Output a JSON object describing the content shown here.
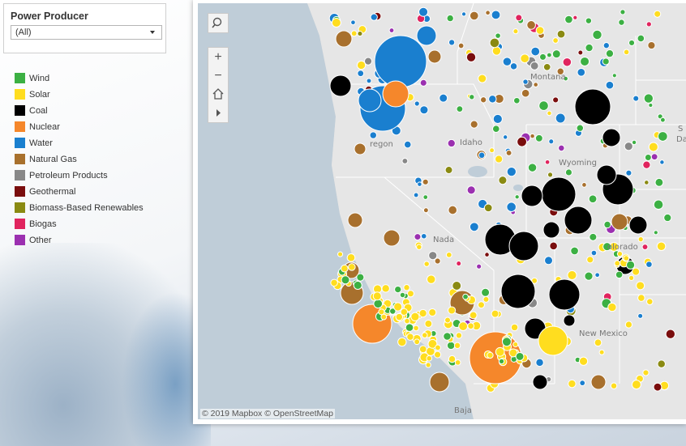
{
  "filter": {
    "title": "Power Producer",
    "value": "(All)"
  },
  "legend": [
    {
      "label": "Wind",
      "color": "#3cb043"
    },
    {
      "label": "Solar",
      "color": "#ffdd1f"
    },
    {
      "label": "Coal",
      "color": "#000000"
    },
    {
      "label": "Nuclear",
      "color": "#f5872b"
    },
    {
      "label": "Water",
      "color": "#1a7fcf"
    },
    {
      "label": "Natural Gas",
      "color": "#a8702d"
    },
    {
      "label": "Petroleum Products",
      "color": "#888888"
    },
    {
      "label": "Geothermal",
      "color": "#7a0d0d"
    },
    {
      "label": "Biomass-Based Renewables",
      "color": "#8a8a12"
    },
    {
      "label": "Biogas",
      "color": "#e0245e"
    },
    {
      "label": "Other",
      "color": "#9b30b0"
    }
  ],
  "map": {
    "attribution": "© 2019 Mapbox  © OpenStreetMap",
    "places": {
      "montana": "Montana",
      "idaho": "Idaho",
      "oregon": "regon",
      "wyoming": "Wyoming",
      "nevada": "Nada",
      "colorado": "olorado",
      "new_mexico": "New Mexico",
      "baja": "Baja",
      "sd": "S",
      "sd2": "Da"
    }
  },
  "controls": {
    "search_icon": "magnifier-icon",
    "zoom_in": "+",
    "zoom_out": "−",
    "home_icon": "home-icon",
    "play_icon": "play-icon"
  }
}
